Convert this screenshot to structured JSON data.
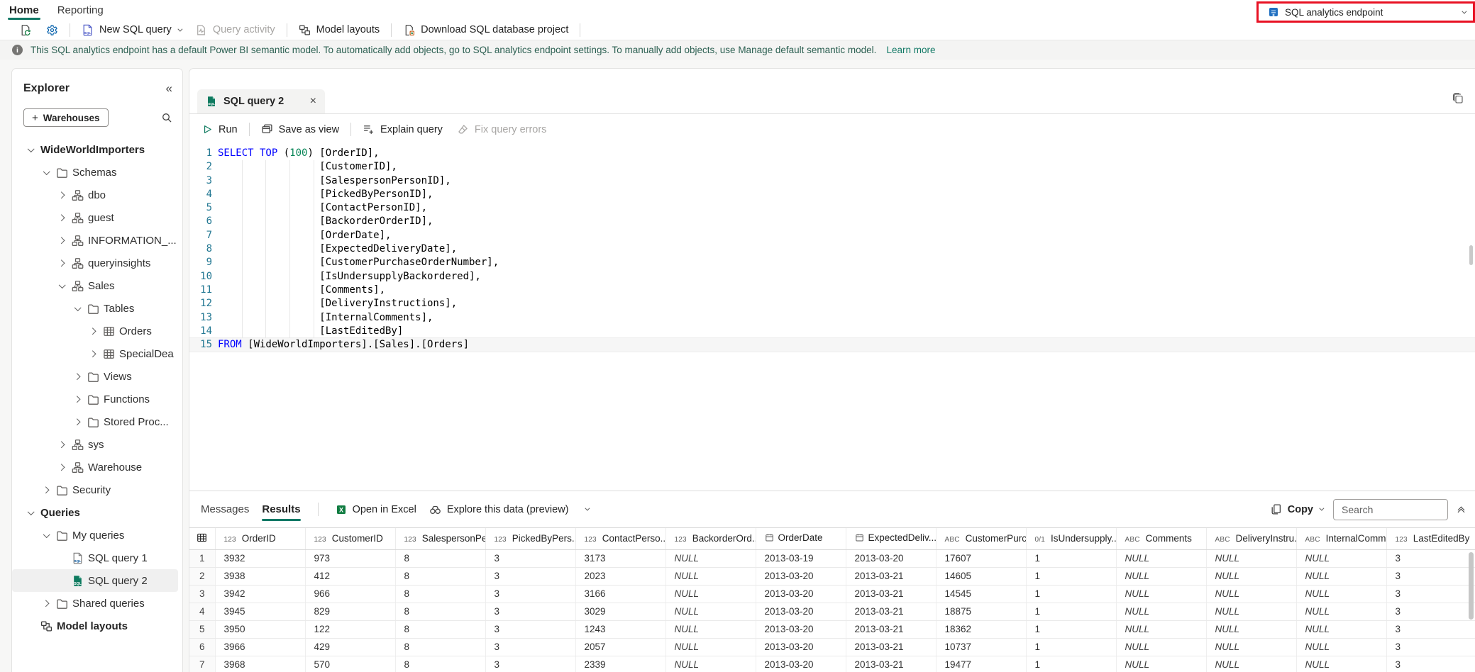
{
  "app": {
    "accent_color": "#117865",
    "annotation_color": "#e81123"
  },
  "top_nav": {
    "home_tab": "Home",
    "reporting_tab": "Reporting",
    "endpoint_label": "SQL analytics endpoint"
  },
  "toolbar": {
    "new_sql_query": "New SQL query",
    "query_activity": "Query activity",
    "model_layouts": "Model layouts",
    "download_project": "Download SQL database project"
  },
  "info_banner": {
    "text": "This SQL analytics endpoint has a default Power BI semantic model. To automatically add objects, go to SQL analytics endpoint settings. To manually add objects, use Manage default semantic model.",
    "link": "Learn more"
  },
  "explorer": {
    "title": "Explorer",
    "warehouses_button": "Warehouses",
    "tree": [
      {
        "label": "WideWorldImporters",
        "chevron": "down",
        "icon": "none",
        "level": 0
      },
      {
        "label": "Schemas",
        "chevron": "down",
        "icon": "folder-icon",
        "level": 1
      },
      {
        "label": "dbo",
        "chevron": "right",
        "icon": "schema-icon",
        "level": 2
      },
      {
        "label": "guest",
        "chevron": "right",
        "icon": "schema-icon",
        "level": 2
      },
      {
        "label": "INFORMATION_...",
        "chevron": "right",
        "icon": "schema-icon",
        "level": 2
      },
      {
        "label": "queryinsights",
        "chevron": "right",
        "icon": "schema-icon",
        "level": 2
      },
      {
        "label": "Sales",
        "chevron": "down",
        "icon": "schema-icon",
        "level": 2
      },
      {
        "label": "Tables",
        "chevron": "down",
        "icon": "folder-icon",
        "level": 3
      },
      {
        "label": "Orders",
        "chevron": "right",
        "icon": "table-icon",
        "level": 4
      },
      {
        "label": "SpecialDea",
        "chevron": "right",
        "icon": "table-icon",
        "level": 4
      },
      {
        "label": "Views",
        "chevron": "right",
        "icon": "folder-icon",
        "level": 3
      },
      {
        "label": "Functions",
        "chevron": "right",
        "icon": "folder-icon",
        "level": 3
      },
      {
        "label": "Stored Proc...",
        "chevron": "right",
        "icon": "folder-icon",
        "level": 3
      },
      {
        "label": "sys",
        "chevron": "right",
        "icon": "schema-icon",
        "level": 2
      },
      {
        "label": "Warehouse",
        "chevron": "right",
        "icon": "schema-icon",
        "level": 2
      },
      {
        "label": "Security",
        "chevron": "right",
        "icon": "folder-icon",
        "level": 1
      },
      {
        "label": "Queries",
        "chevron": "down",
        "icon": "none",
        "level": 0
      },
      {
        "label": "My queries",
        "chevron": "down",
        "icon": "folder-icon",
        "level": 1
      },
      {
        "label": "SQL query 1",
        "chevron": "none",
        "icon": "sql-file-icon",
        "level": 2
      },
      {
        "label": "SQL query 2",
        "chevron": "none",
        "icon": "sql-file-green-icon",
        "level": 2,
        "selected": true
      },
      {
        "label": "Shared queries",
        "chevron": "right",
        "icon": "folder-icon",
        "level": 1
      },
      {
        "label": "Model layouts",
        "chevron": "none",
        "icon": "model-layouts-icon",
        "level": 0
      }
    ]
  },
  "editor": {
    "tab_title": "SQL query 2",
    "toolbar": {
      "run": "Run",
      "save_as_view": "Save as view",
      "explain_query": "Explain query",
      "fix_query_errors": "Fix query errors"
    },
    "lines": [
      {
        "n": "1",
        "kw": "SELECT TOP ",
        "pre": "(",
        "num": "100",
        "text": ") [OrderID],"
      },
      {
        "n": "2",
        "text": "                 [CustomerID],"
      },
      {
        "n": "3",
        "text": "                 [SalespersonPersonID],"
      },
      {
        "n": "4",
        "text": "                 [PickedByPersonID],"
      },
      {
        "n": "5",
        "text": "                 [ContactPersonID],"
      },
      {
        "n": "6",
        "text": "                 [BackorderOrderID],"
      },
      {
        "n": "7",
        "text": "                 [OrderDate],"
      },
      {
        "n": "8",
        "text": "                 [ExpectedDeliveryDate],"
      },
      {
        "n": "9",
        "text": "                 [CustomerPurchaseOrderNumber],"
      },
      {
        "n": "10",
        "text": "                 [IsUndersupplyBackordered],"
      },
      {
        "n": "11",
        "text": "                 [Comments],"
      },
      {
        "n": "12",
        "text": "                 [DeliveryInstructions],"
      },
      {
        "n": "13",
        "text": "                 [InternalComments],"
      },
      {
        "n": "14",
        "text": "                 [LastEditedBy]"
      },
      {
        "n": "15",
        "kw": "FROM",
        "text": " [WideWorldImporters].[Sales].[Orders]"
      }
    ]
  },
  "results": {
    "messages_tab": "Messages",
    "results_tab": "Results",
    "open_in_excel": "Open in Excel",
    "explore_data": "Explore this data (preview)",
    "copy": "Copy",
    "search_placeholder": "Search",
    "columns": [
      {
        "badge": "123",
        "label": "OrderID"
      },
      {
        "badge": "123",
        "label": "CustomerID"
      },
      {
        "badge": "123",
        "label": "SalespersonPe..."
      },
      {
        "badge": "123",
        "label": "PickedByPers..."
      },
      {
        "badge": "123",
        "label": "ContactPerso..."
      },
      {
        "badge": "123",
        "label": "BackorderOrd..."
      },
      {
        "badge": "date",
        "label": "OrderDate"
      },
      {
        "badge": "date",
        "label": "ExpectedDeliv..."
      },
      {
        "badge": "ABC",
        "label": "CustomerPurc..."
      },
      {
        "badge": "0/1",
        "label": "IsUndersupply..."
      },
      {
        "badge": "ABC",
        "label": "Comments"
      },
      {
        "badge": "ABC",
        "label": "DeliveryInstru..."
      },
      {
        "badge": "ABC",
        "label": "InternalComm..."
      },
      {
        "badge": "123",
        "label": "LastEditedBy"
      }
    ],
    "rows": [
      {
        "i": "1",
        "c": [
          "3932",
          "973",
          "8",
          "3",
          "3173",
          "NULL",
          "2013-03-19",
          "2013-03-20",
          "17607",
          "1",
          "NULL",
          "NULL",
          "NULL",
          "3"
        ]
      },
      {
        "i": "2",
        "c": [
          "3938",
          "412",
          "8",
          "3",
          "2023",
          "NULL",
          "2013-03-20",
          "2013-03-21",
          "14605",
          "1",
          "NULL",
          "NULL",
          "NULL",
          "3"
        ]
      },
      {
        "i": "3",
        "c": [
          "3942",
          "966",
          "8",
          "3",
          "3166",
          "NULL",
          "2013-03-20",
          "2013-03-21",
          "14545",
          "1",
          "NULL",
          "NULL",
          "NULL",
          "3"
        ]
      },
      {
        "i": "4",
        "c": [
          "3945",
          "829",
          "8",
          "3",
          "3029",
          "NULL",
          "2013-03-20",
          "2013-03-21",
          "18875",
          "1",
          "NULL",
          "NULL",
          "NULL",
          "3"
        ]
      },
      {
        "i": "5",
        "c": [
          "3950",
          "122",
          "8",
          "3",
          "1243",
          "NULL",
          "2013-03-20",
          "2013-03-21",
          "18362",
          "1",
          "NULL",
          "NULL",
          "NULL",
          "3"
        ]
      },
      {
        "i": "6",
        "c": [
          "3966",
          "429",
          "8",
          "3",
          "2057",
          "NULL",
          "2013-03-20",
          "2013-03-21",
          "10737",
          "1",
          "NULL",
          "NULL",
          "NULL",
          "3"
        ]
      },
      {
        "i": "7",
        "c": [
          "3968",
          "570",
          "8",
          "3",
          "2339",
          "NULL",
          "2013-03-20",
          "2013-03-21",
          "19477",
          "1",
          "NULL",
          "NULL",
          "NULL",
          "3"
        ]
      }
    ]
  }
}
